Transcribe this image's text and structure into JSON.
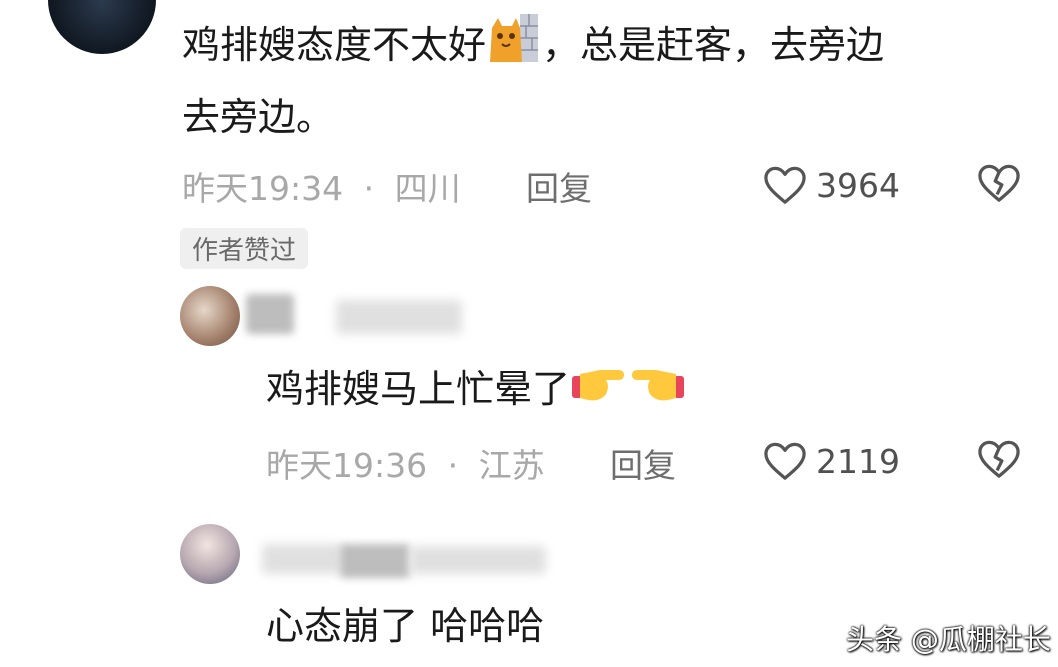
{
  "comments": [
    {
      "text_line1": "鸡排嫂态度不太好",
      "text_line1_tail": "，总是赶客，去旁边",
      "text_line2": "去旁边。",
      "time": "昨天19:34",
      "location": "四川",
      "reply_label": "回复",
      "likes": "3964",
      "badge": "作者赞过",
      "emoji": "cat-wall-emoji"
    },
    {
      "text": "鸡排嫂马上忙晕了",
      "time": "昨天19:36",
      "location": "江苏",
      "reply_label": "回复",
      "likes": "2119",
      "emoji": "pointing-hands-emoji"
    },
    {
      "text": "心态崩了 哈哈哈"
    }
  ],
  "separator": "·",
  "watermark": "头条 @瓜棚社长",
  "icons": {
    "like": "heart-outline-icon",
    "dislike": "broken-heart-icon"
  },
  "colors": {
    "text": "#1a1a1a",
    "meta": "#a8a8a8",
    "icon": "#555555"
  }
}
